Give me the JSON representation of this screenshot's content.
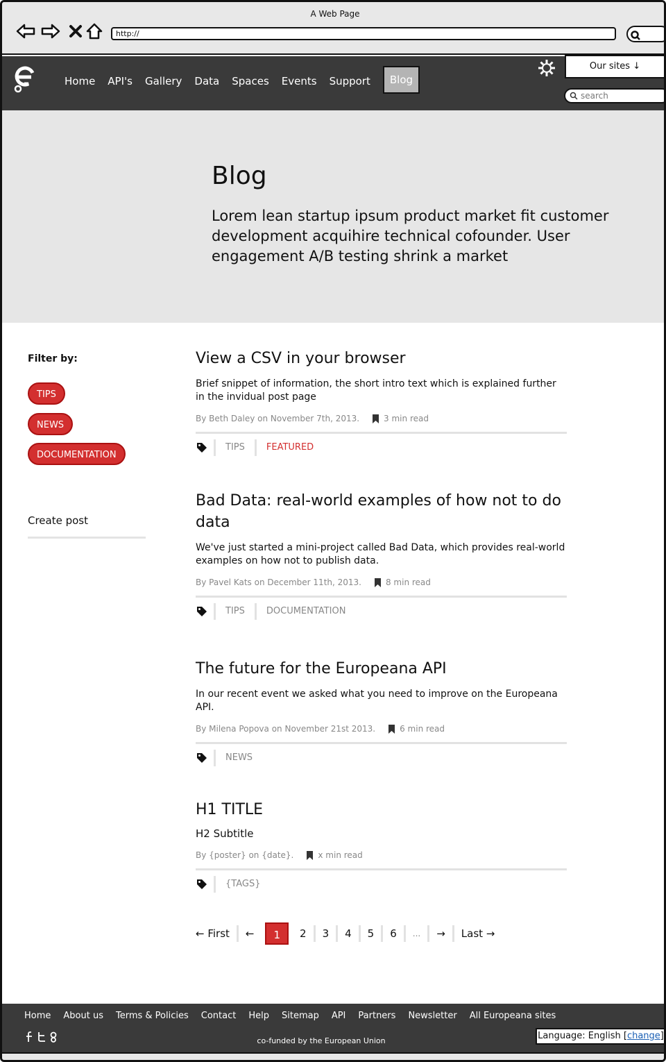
{
  "browser": {
    "title": "A Web Page",
    "url": "http://"
  },
  "header": {
    "nav": [
      "Home",
      "API's",
      "Gallery",
      "Data",
      "Spaces",
      "Events",
      "Support",
      "Blog"
    ],
    "active": "Blog",
    "our_sites": "Our sites ↓",
    "search_placeholder": "search"
  },
  "hero": {
    "title": "Blog",
    "text": "Lorem lean startup ipsum product market fit customer development acquihire technical cofounder. User engagement A/B testing shrink a market"
  },
  "sidebar": {
    "filter_label": "Filter by:",
    "filters": [
      "TIPS",
      "NEWS",
      "DOCUMENTATION"
    ],
    "create_post": "Create post"
  },
  "posts": [
    {
      "title": "View a CSV in your browser",
      "snippet": "Brief snippet of information, the short intro text which is explained further in the invidual post page",
      "byline": "By Beth Daley on November 7th, 2013.",
      "read_time": "3 min read",
      "tags": [
        "TIPS",
        "FEATURED"
      ]
    },
    {
      "title": "Bad Data: real-world examples of how not to do data",
      "snippet": "We've just started a mini-project called Bad Data, which provides real-world examples on how not to publish data.",
      "byline": "By Pavel Kats on December 11th, 2013.",
      "read_time": "8 min read",
      "tags": [
        "TIPS",
        "DOCUMENTATION"
      ]
    },
    {
      "title": "The future for the Europeana API",
      "snippet": "In our recent event we asked what you need to improve on the Europeana API.",
      "byline": "By Milena Popova on November 21st 2013.",
      "read_time": "6 min read",
      "tags": [
        "NEWS"
      ]
    },
    {
      "title": "H1 TITLE",
      "snippet": "H2 Subtitle",
      "byline": "By {poster} on {date}.",
      "read_time": "x min read",
      "tags": [
        "{TAGS}"
      ]
    }
  ],
  "pagination": {
    "first": "← First",
    "prev": "←",
    "pages": [
      "1",
      "2",
      "3",
      "4",
      "5",
      "6"
    ],
    "current": "1",
    "ellipsis": "...",
    "next": "→",
    "last": "Last →"
  },
  "footer": {
    "nav": [
      "Home",
      "About us",
      "Terms & Policies",
      "Contact",
      "Help",
      "Sitemap",
      "API",
      "Partners",
      "Newsletter",
      "All Europeana sites"
    ],
    "cofunded": "co-funded by the European Union",
    "language_label": "Language: English",
    "language_change": "change"
  },
  "colors": {
    "accent": "#d32f2f",
    "header_bg": "#3a3a3a",
    "hero_bg": "#e6e6e6"
  }
}
